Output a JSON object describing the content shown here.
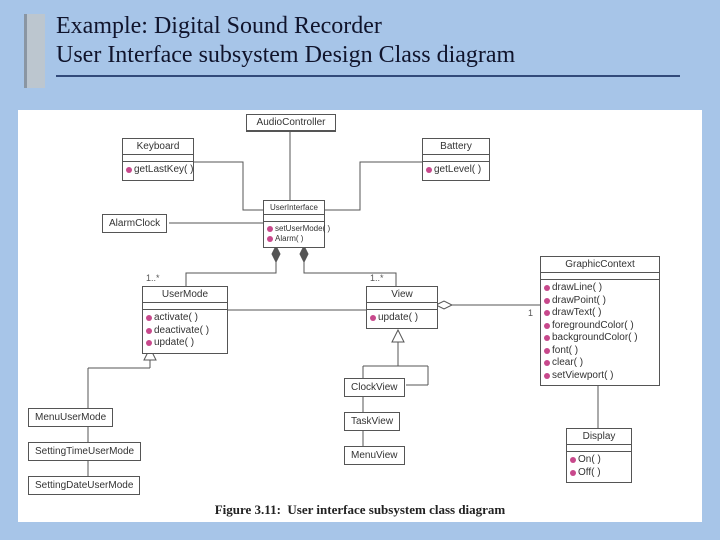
{
  "title_line1": "Example: Digital Sound Recorder",
  "title_line2": "User Interface subsystem Design Class diagram",
  "caption_label": "Figure 3.11:",
  "caption_text": "User interface subsystem class diagram",
  "classes": {
    "AudioController": {
      "name": "AudioController"
    },
    "Keyboard": {
      "name": "Keyboard",
      "ops": [
        "getLastKey( )"
      ]
    },
    "Battery": {
      "name": "Battery",
      "ops": [
        "getLevel( )"
      ]
    },
    "AlarmClock": {
      "name": "AlarmClock"
    },
    "UserInterface": {
      "name": "UserInterface",
      "ops": [
        "setUserMode( )",
        "Alarm( )"
      ]
    },
    "UserMode": {
      "name": "UserMode",
      "ops": [
        "activate( )",
        "deactivate( )",
        "update( )"
      ]
    },
    "View": {
      "name": "View",
      "ops": [
        "update( )"
      ]
    },
    "GraphicContext": {
      "name": "GraphicContext",
      "ops": [
        "drawLine( )",
        "drawPoint( )",
        "drawText( )",
        "foregroundColor( )",
        "backgroundColor( )",
        "font( )",
        "clear( )",
        "setViewport( )"
      ]
    },
    "ClockView": {
      "name": "ClockView"
    },
    "TaskView": {
      "name": "TaskView"
    },
    "MenuView": {
      "name": "MenuView"
    },
    "Display": {
      "name": "Display",
      "ops": [
        "On( )",
        "Off( )"
      ]
    },
    "MenuUserMode": {
      "name": "MenuUserMode"
    },
    "SettingTimeUserMode": {
      "name": "SettingTimeUserMode"
    },
    "SettingDateUserMode": {
      "name": "SettingDateUserMode"
    }
  },
  "multiplicities": {
    "um_left": "1..*",
    "view_left": "1..*",
    "gc_left": "1"
  }
}
